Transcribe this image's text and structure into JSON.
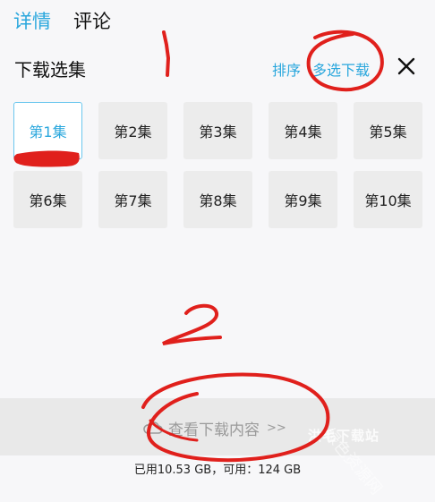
{
  "tabs": [
    {
      "label": "详情",
      "active": true
    },
    {
      "label": "评论",
      "active": false
    }
  ],
  "header": {
    "title": "下载选集",
    "sort_label": "排序",
    "multi_select_label": "多选下载",
    "close_icon": "close-icon"
  },
  "episodes": [
    {
      "label": "第1集",
      "selected": true
    },
    {
      "label": "第2集",
      "selected": false
    },
    {
      "label": "第3集",
      "selected": false
    },
    {
      "label": "第4集",
      "selected": false
    },
    {
      "label": "第5集",
      "selected": false
    },
    {
      "label": "第6集",
      "selected": false
    },
    {
      "label": "第7集",
      "selected": false
    },
    {
      "label": "第8集",
      "selected": false
    },
    {
      "label": "第9集",
      "selected": false
    },
    {
      "label": "第10集",
      "selected": false
    }
  ],
  "bottom": {
    "view_downloads_label": "查看下载内容",
    "arrows": ">>",
    "cloud_icon": "cloud-icon",
    "storage_text": "已用10.53 GB，可用：124 GB"
  },
  "watermark": {
    "text1": "洪毛下载站",
    "text2": "绿色资源网"
  },
  "colors": {
    "accent": "#2aa7dd",
    "annotation": "#e0201c"
  }
}
